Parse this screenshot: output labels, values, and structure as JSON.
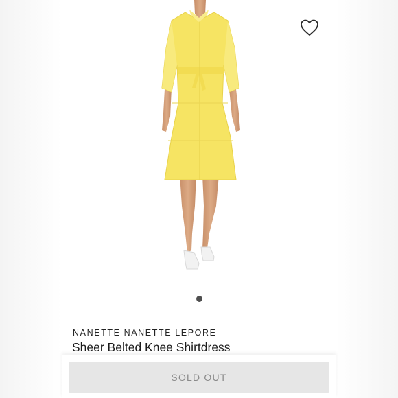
{
  "product": {
    "brand": "NANETTE NANETTE LEPORE",
    "title": "Sheer Belted Knee Shirtdress",
    "image_alt": "Model wearing a yellow sheer belted shirtdress with white sandals",
    "dress_color": "#f6e463",
    "gallery_dots": 1
  },
  "actions": {
    "favorite_icon": "heart-outline-icon",
    "sold_out_label": "SOLD OUT"
  }
}
